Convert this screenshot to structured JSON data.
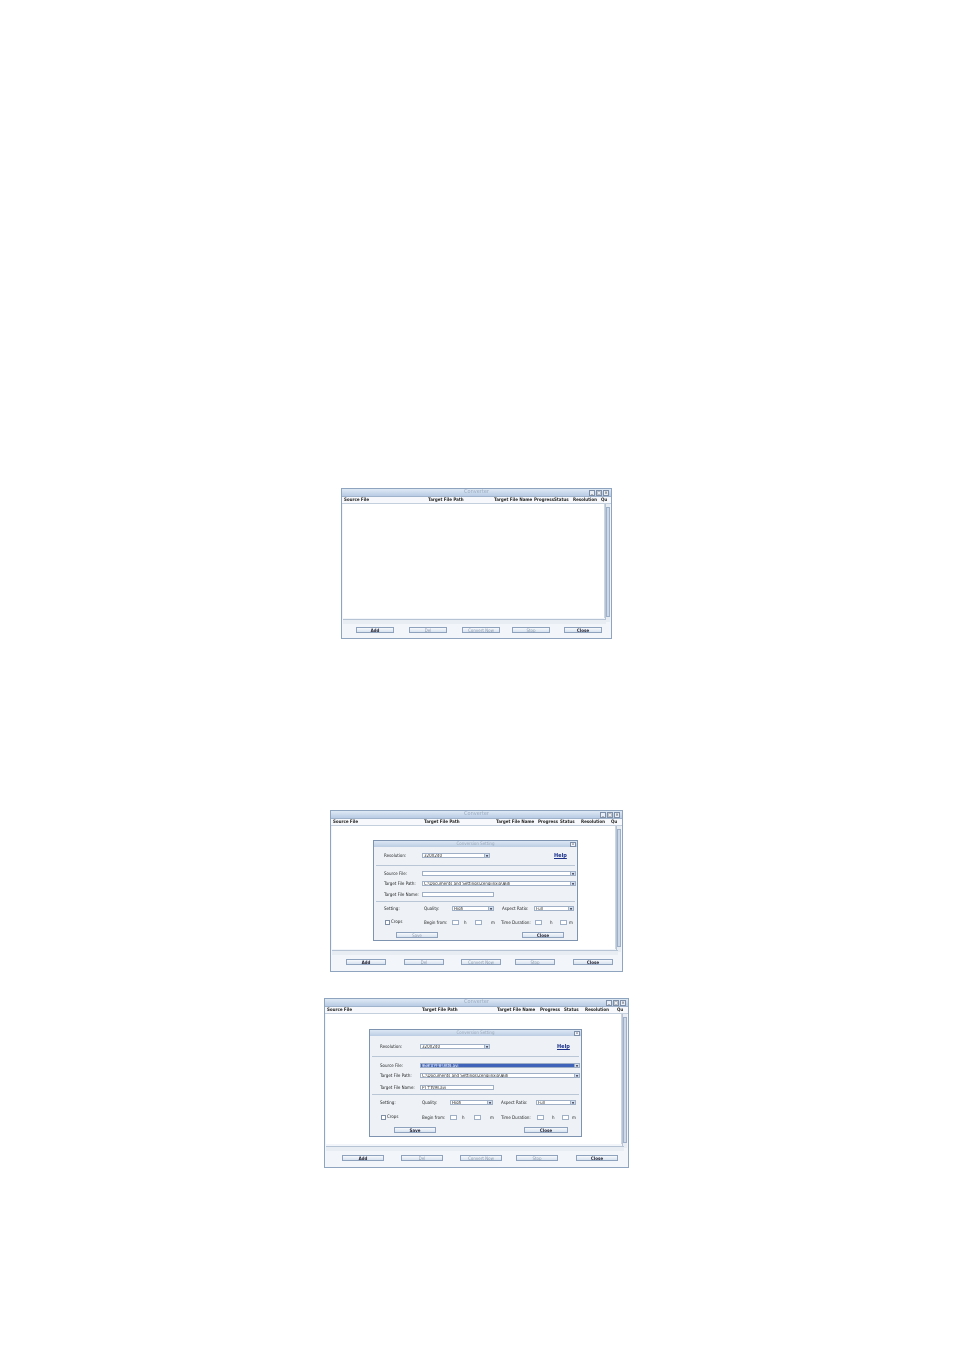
{
  "app": {
    "window_title": "Converter",
    "columns": [
      "Source File",
      "Target File Path",
      "Target File Name",
      "Progress",
      "Status",
      "Resolution",
      "Qu"
    ],
    "buttons": {
      "add": "Add",
      "del": "Del",
      "convert": "Convert Now",
      "stop": "Stop",
      "close": "Close"
    }
  },
  "dialog": {
    "title": "Conversion Setting",
    "help": "Help",
    "resolution_label": "Resolution:",
    "resolution_value_a": "320X240",
    "resolution_value_b": "320X240",
    "source_file_label": "Source File:",
    "source_file_value": "",
    "source_file_value_b": "新建文件夹\\视频.avi",
    "target_path_label": "Target File Path:",
    "target_path_value": "C:\\Documents and Settings\\Zengjinxia\\桌面",
    "target_name_label": "Target File Name:",
    "target_name_value": "",
    "target_name_value_b": "PT工程图.avi",
    "setting_label": "Setting:",
    "quality_label": "Quality:",
    "quality_value": "High",
    "aspect_label": "Aspect Ratio:",
    "aspect_value": "Full",
    "crops_label": "Crops",
    "begin_label": "Begin from:",
    "h_label": "h",
    "m_label": "m",
    "dur_label": "Time Duration:",
    "save": "Save",
    "close": "Close"
  }
}
